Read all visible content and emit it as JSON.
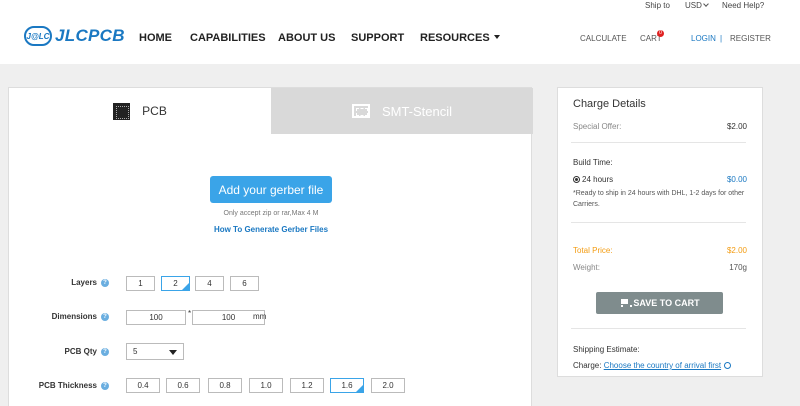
{
  "topbar": {
    "ship_to": "Ship to",
    "currency": "USD",
    "help": "Need Help?"
  },
  "brand": {
    "badge": "J@LC",
    "name": "JLCPCB",
    "color": "#1a78c2"
  },
  "nav": {
    "home": "HOME",
    "capabilities": "CAPABILITIES",
    "about": "ABOUT US",
    "support": "SUPPORT",
    "resources": "RESOURCES",
    "calculate": "CALCULATE",
    "cart": "CART",
    "cart_count": "0",
    "login": "LOGIN",
    "separator": "|",
    "register": "REGISTER"
  },
  "tabs": {
    "pcb": "PCB",
    "smt": "SMT-Stencil"
  },
  "upload": {
    "button": "Add your gerber file",
    "note": "Only accept zip or rar,Max 4 M",
    "link": "How To Generate Gerber Files"
  },
  "form": {
    "layers": {
      "label": "Layers",
      "options": [
        "1",
        "2",
        "4",
        "6"
      ],
      "selected": "2"
    },
    "dimensions": {
      "label": "Dimensions",
      "width": "100",
      "height": "100",
      "separator": "*",
      "unit": "mm"
    },
    "qty": {
      "label": "PCB Qty",
      "value": "5"
    },
    "thickness": {
      "label": "PCB Thickness",
      "options": [
        "0.4",
        "0.6",
        "0.8",
        "1.0",
        "1.2",
        "1.6",
        "2.0"
      ],
      "selected": "1.6"
    },
    "help_glyph": "?"
  },
  "charge": {
    "title": "Charge Details",
    "special_offer_label": "Special Offer:",
    "special_offer_value": "$2.00",
    "build_time_label": "Build Time:",
    "build_option": "24 hours",
    "build_price": "$0.00",
    "build_note": "*Ready to ship in 24 hours with DHL, 1-2 days for other Carriers.",
    "total_label": "Total Price:",
    "total_value": "$2.00",
    "weight_label": "Weight:",
    "weight_value": "170g",
    "cart_button": "SAVE TO CART",
    "shipping_label": "Shipping Estimate:",
    "charge_label": "Charge:",
    "country_link": "Choose the country of arrival first"
  },
  "colors": {
    "accent": "#3aa4e8",
    "orange": "#f39c12",
    "cart_button": "#7f8c8d"
  }
}
